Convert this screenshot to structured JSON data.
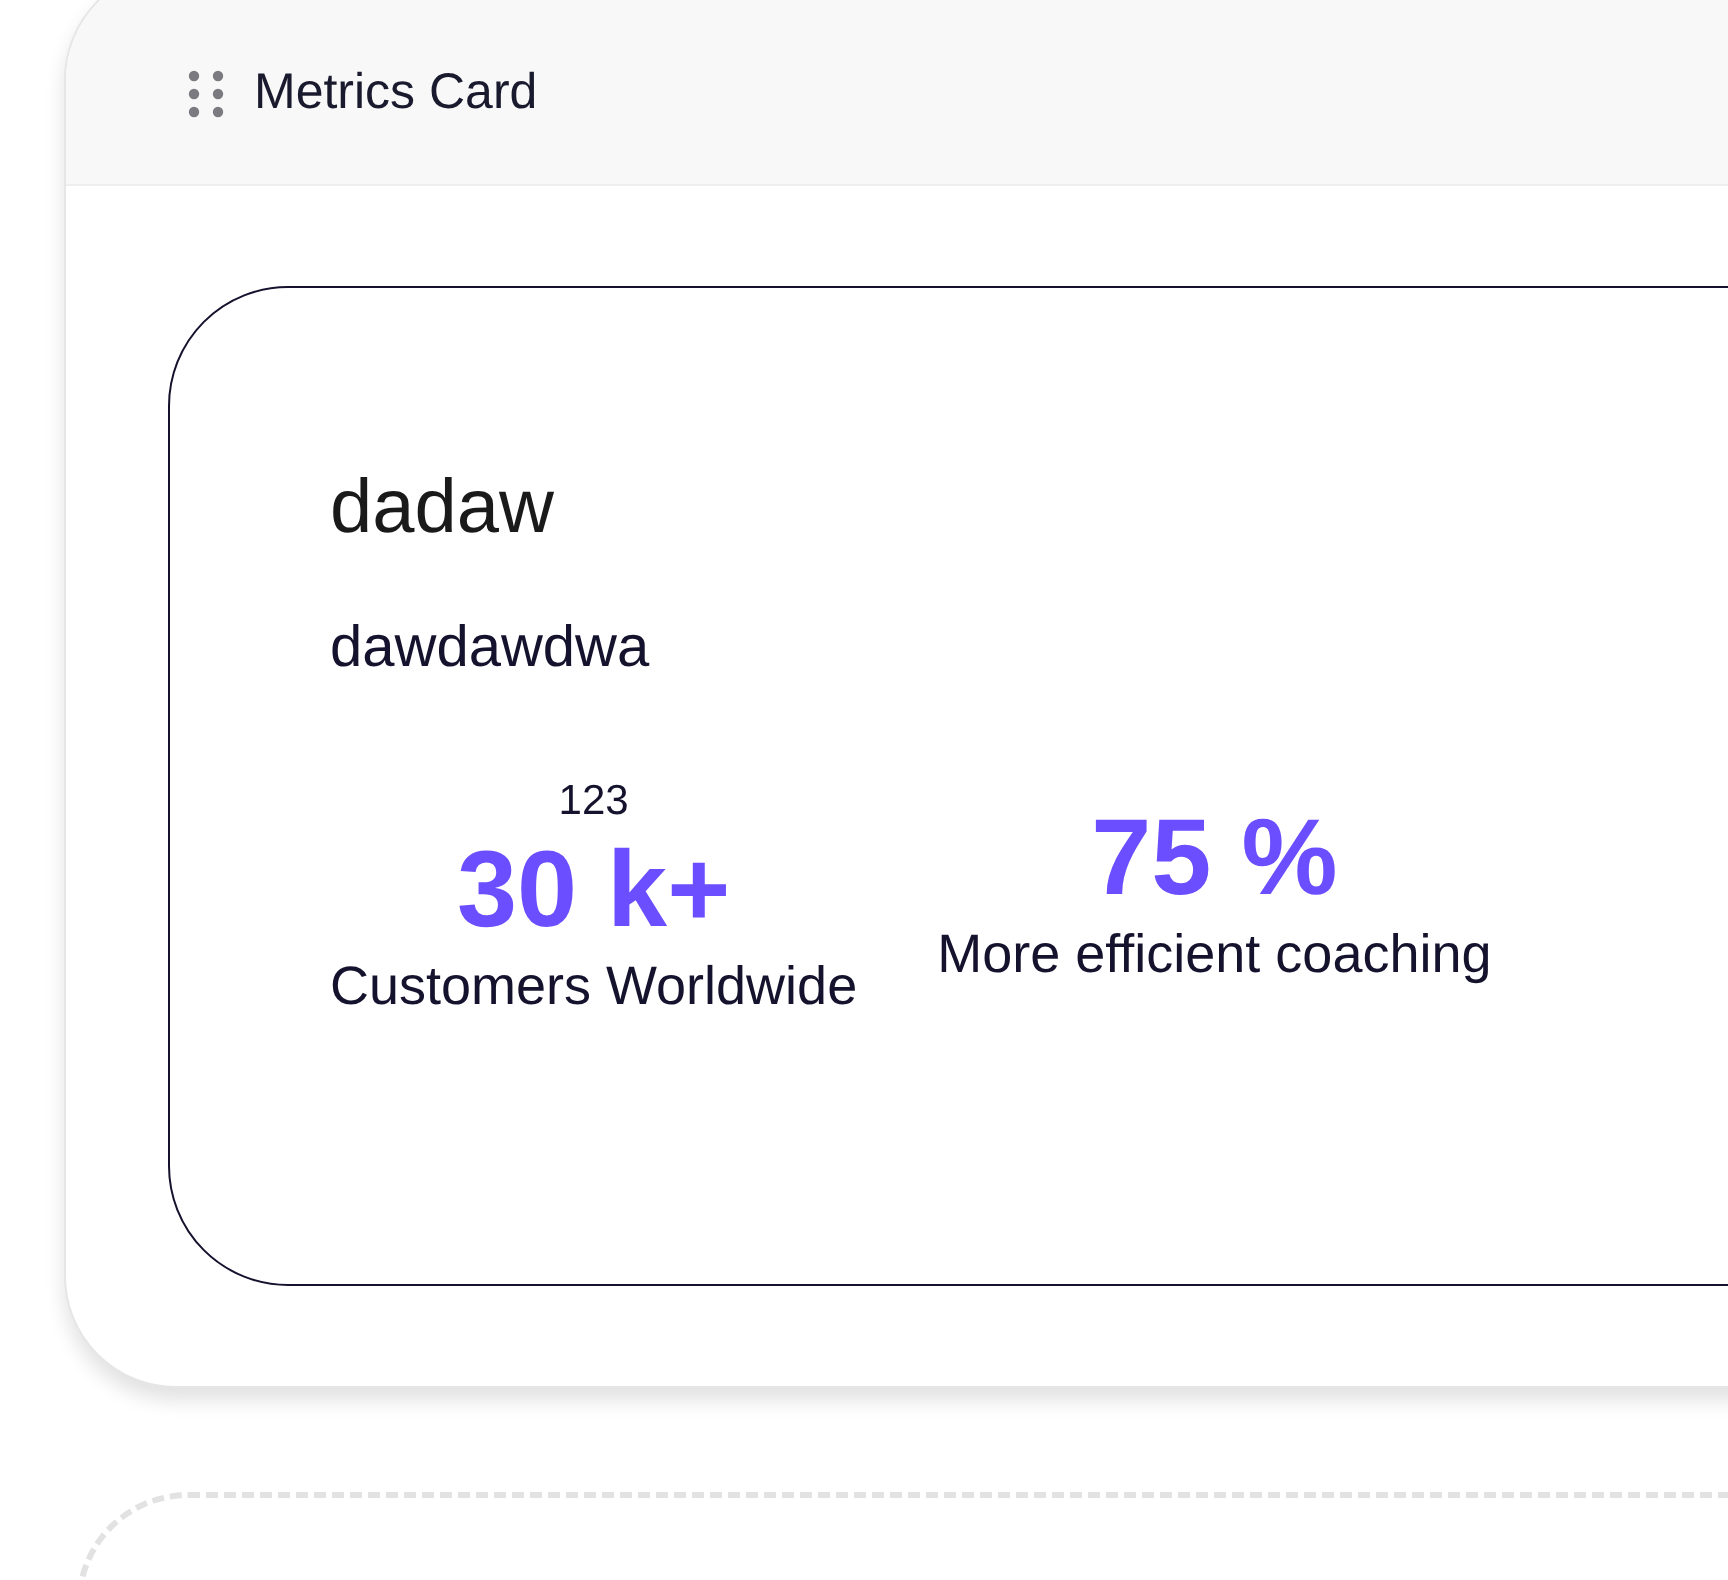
{
  "panel": {
    "title": "Metrics Card"
  },
  "card": {
    "heading": "dadaw",
    "subheading": "dawdawdwa",
    "metrics": [
      {
        "label_above": "123",
        "value": "30 k+",
        "caption": "Customers Worldwide"
      },
      {
        "value": "75 %",
        "caption": "More efficient coaching"
      }
    ]
  }
}
